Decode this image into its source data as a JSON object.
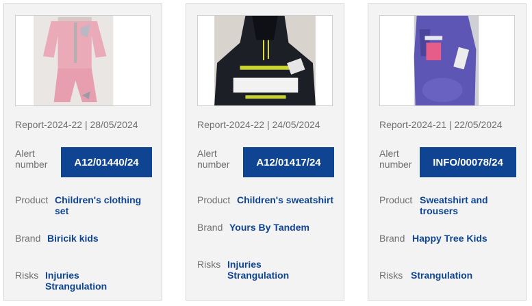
{
  "cards": [
    {
      "image_desc": "pink-childrens-clothing-set-photo",
      "report": "Report-2024-22 | 28/05/2024",
      "alert_label": "Alert number",
      "alert_number": "A12/01440/24",
      "product_label": "Product",
      "product": [
        "Children's clothing",
        "set"
      ],
      "brand_label": "Brand",
      "brand": "Biricik kids",
      "risks_label": "Risks",
      "risks": [
        "Injuries",
        "Strangulation"
      ]
    },
    {
      "image_desc": "black-chicago-sweatshirt-photo",
      "report": "Report-2024-22 | 24/05/2024",
      "alert_label": "Alert number",
      "alert_number": "A12/01417/24",
      "product_label": "Product",
      "product": [
        "Children's sweatshirt"
      ],
      "brand_label": "Brand",
      "brand": "Yours By Tandem",
      "risks_label": "Risks",
      "risks": [
        "Injuries",
        "Strangulation"
      ]
    },
    {
      "image_desc": "purple-sweatshirt-and-trousers-photo",
      "report": "Report-2024-21 | 22/05/2024",
      "alert_label": "Alert number",
      "alert_number": "INFO/00078/24",
      "product_label": "Product",
      "product": [
        "Sweatshirt and",
        "trousers"
      ],
      "brand_label": "Brand",
      "brand": "Happy Tree Kids",
      "risks_label": "Risks",
      "risks": [
        "Strangulation"
      ]
    }
  ],
  "colors": {
    "accent": "#0e4492",
    "card_bg": "#f3f3f3",
    "muted_text": "#6f6f6f"
  }
}
